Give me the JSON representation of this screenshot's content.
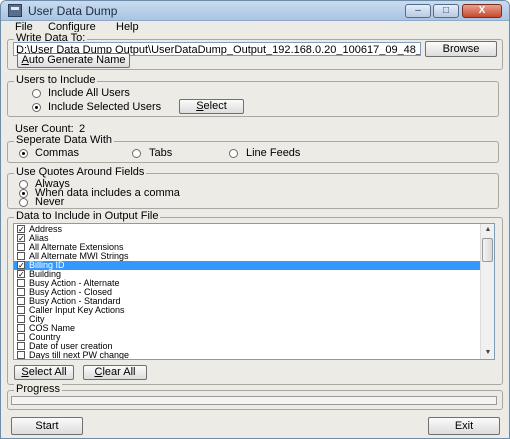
{
  "window": {
    "title": "User Data Dump"
  },
  "titlebar_buttons": {
    "minimize": "–",
    "maximize": "□",
    "close": "X"
  },
  "menu": [
    "File",
    "Configure",
    "Help"
  ],
  "write_data": {
    "label": "Write Data To:",
    "path": "D:\\User Data Dump Output\\UserDataDump_Output_192.168.0.20_100617_09_48_",
    "browse": "Browse",
    "auto_generate_prefix": "A",
    "auto_generate_rest": "uto Generate Name"
  },
  "users": {
    "label": "Users to Include",
    "all": "Include All Users",
    "selected": "Include Selected Users",
    "select_prefix": "S",
    "select_rest": "elect",
    "count_label": "User Count:",
    "count": "2"
  },
  "separate": {
    "label": "Seperate Data With",
    "commas": "Commas",
    "tabs": "Tabs",
    "line_feeds": "Line Feeds"
  },
  "quotes": {
    "label": "Use Quotes Around Fields",
    "always": "Always",
    "comma": "When data includes a comma",
    "never": "Never"
  },
  "data_fields": {
    "label": "Data to Include in Output File",
    "items": [
      {
        "label": "Address",
        "checked": true
      },
      {
        "label": "Alias",
        "checked": true
      },
      {
        "label": "All Alternate Extensions",
        "checked": false
      },
      {
        "label": "All Alternate MWI Strings",
        "checked": false
      },
      {
        "label": "Billing ID",
        "checked": true
      },
      {
        "label": "Building",
        "checked": true
      },
      {
        "label": "Busy Action - Alternate",
        "checked": false
      },
      {
        "label": "Busy Action - Closed",
        "checked": false
      },
      {
        "label": "Busy Action - Standard",
        "checked": false
      },
      {
        "label": "Caller Input Key Actions",
        "checked": false
      },
      {
        "label": "City",
        "checked": false
      },
      {
        "label": "COS Name",
        "checked": false
      },
      {
        "label": "Country",
        "checked": false
      },
      {
        "label": "Date of user creation",
        "checked": false
      },
      {
        "label": "Days till next PW change",
        "checked": false
      }
    ],
    "selected_index": 4,
    "select_all_prefix": "S",
    "select_all_rest": "elect All",
    "clear_all_prefix": "C",
    "clear_all_rest": "lear All"
  },
  "progress": {
    "label": "Progress",
    "fraction": 0.0
  },
  "footer": {
    "start": "Start",
    "exit": "Exit"
  }
}
